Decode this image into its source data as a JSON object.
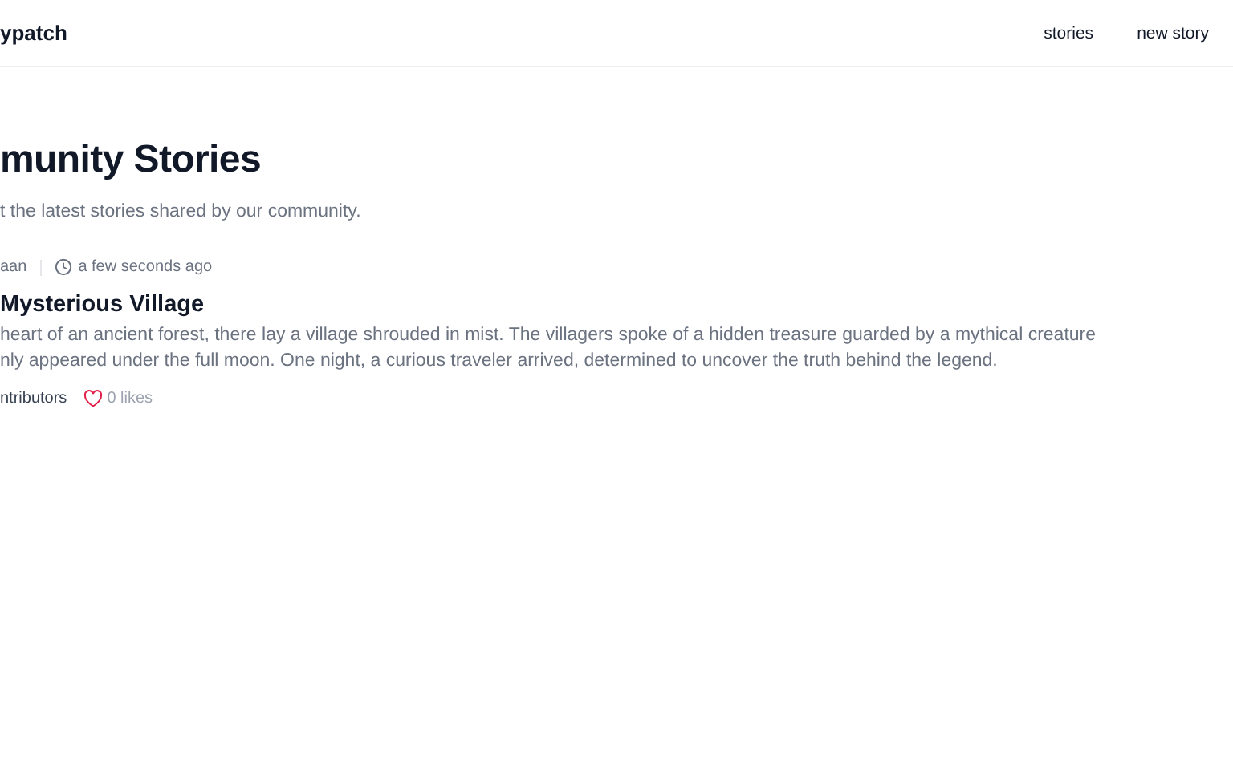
{
  "header": {
    "logo": "ypatch",
    "nav": [
      "stories",
      "new story"
    ]
  },
  "page": {
    "title": "munity Stories",
    "subtitle": "t the latest stories shared by our community."
  },
  "stories": [
    {
      "author": "aan",
      "time": "a few seconds ago",
      "title": "Mysterious Village",
      "body": [
        "heart of an ancient forest, there lay a village shrouded in mist. The villagers spoke of a hidden treasure guarded by a mythical creature",
        "nly appeared under the full moon. One night, a curious traveler arrived, determined to uncover the truth behind the legend."
      ],
      "contributors": "ntributors",
      "likes": "0 likes",
      "liked": false
    }
  ]
}
